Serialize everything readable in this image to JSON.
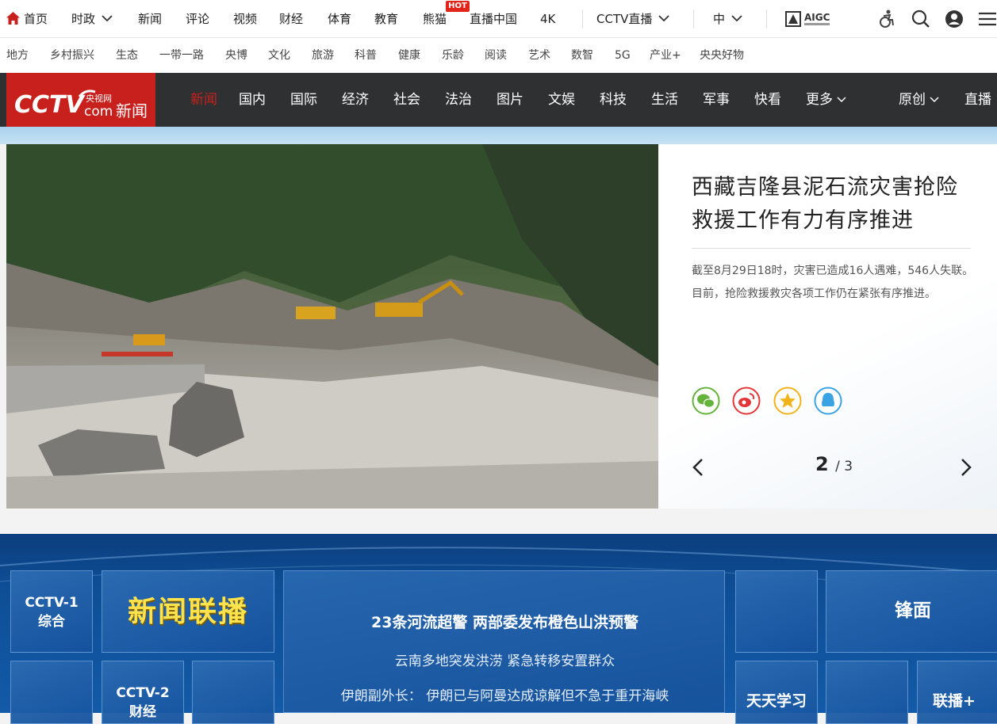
{
  "top_nav": {
    "home": "首页",
    "items": [
      "时政",
      "新闻",
      "评论",
      "视频",
      "财经",
      "体育",
      "教育",
      "熊猫",
      "直播中国",
      "4K"
    ],
    "hot_badge": "HOT",
    "live": "CCTV直播",
    "lang": "中",
    "aigc": "AIGC"
  },
  "sub_nav": [
    "地方",
    "乡村振兴",
    "生态",
    "一带一路",
    "央博",
    "文化",
    "旅游",
    "科普",
    "健康",
    "乐龄",
    "阅读",
    "艺术",
    "数智",
    "5G",
    "产业+",
    "央央好物"
  ],
  "news_nav": {
    "logo_text": "CCTV.com 新闻",
    "items": [
      "新闻",
      "国内",
      "国际",
      "经济",
      "社会",
      "法治",
      "图片",
      "文娱",
      "科技",
      "生活",
      "军事",
      "快看"
    ],
    "more": "更多",
    "original": "原创",
    "live": "直播"
  },
  "featured": {
    "headline": "西藏吉隆县泥石流灾害抢险救援工作有力有序推进",
    "summary": "截至8月29日18时，灾害已造成16人遇难，546人失联。目前，抢险救援救灾各项工作仍在紧张有序推进。",
    "page_current": "2",
    "page_total": "/ 3"
  },
  "live_panel": {
    "cctv1": "CCTV-1",
    "cctv1_sub": "综合",
    "xwlb": "新闻联播",
    "cctv2": "CCTV-2",
    "cctv2_sub": "财经",
    "lead": "23条河流超警 两部委发布橙色山洪预警",
    "line1": "云南多地突发洪涝 紧急转移安置群众",
    "line2": "伊朗副外长： 伊朗已与阿曼达成谅解但不急于重开海峡",
    "fengmian": "锋面",
    "tiantian": "天天学习",
    "lianbo": "联播+"
  },
  "colors": {
    "brand_red": "#c8201d",
    "dark_bar": "#2e3032",
    "panel_blue": "#135aa8",
    "title_yellow": "#ffe34d"
  }
}
